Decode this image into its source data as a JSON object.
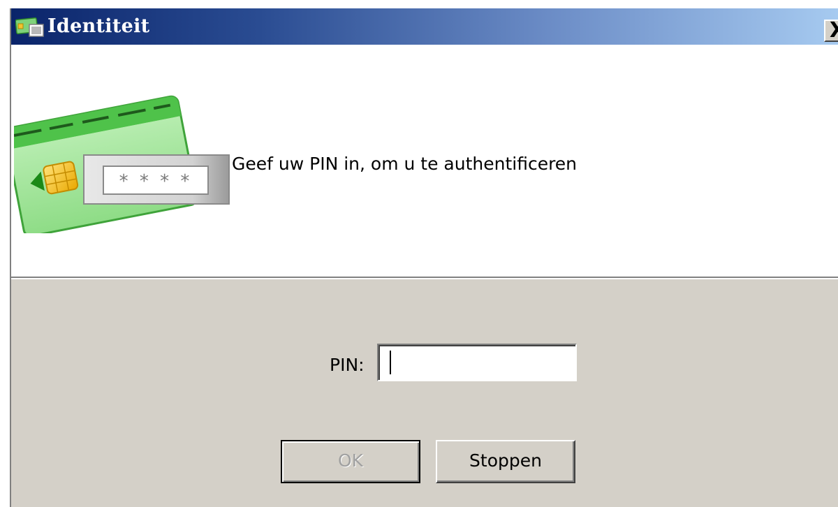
{
  "window": {
    "title": "Identiteit",
    "close_label": "X"
  },
  "header": {
    "instruction": "Geef uw PIN in, om u te authentificeren",
    "illustration": {
      "pin_mask": "* * * *"
    }
  },
  "form": {
    "pin_label": "PIN:",
    "pin_value": "",
    "pin_placeholder": ""
  },
  "buttons": {
    "ok_label": "OK",
    "ok_enabled": false,
    "cancel_label": "Stoppen"
  },
  "colors": {
    "titlebar_start": "#0a246a",
    "titlebar_end": "#a6caf0",
    "dialog_background": "#d4d0c8",
    "card_green": "#9ee49a"
  }
}
